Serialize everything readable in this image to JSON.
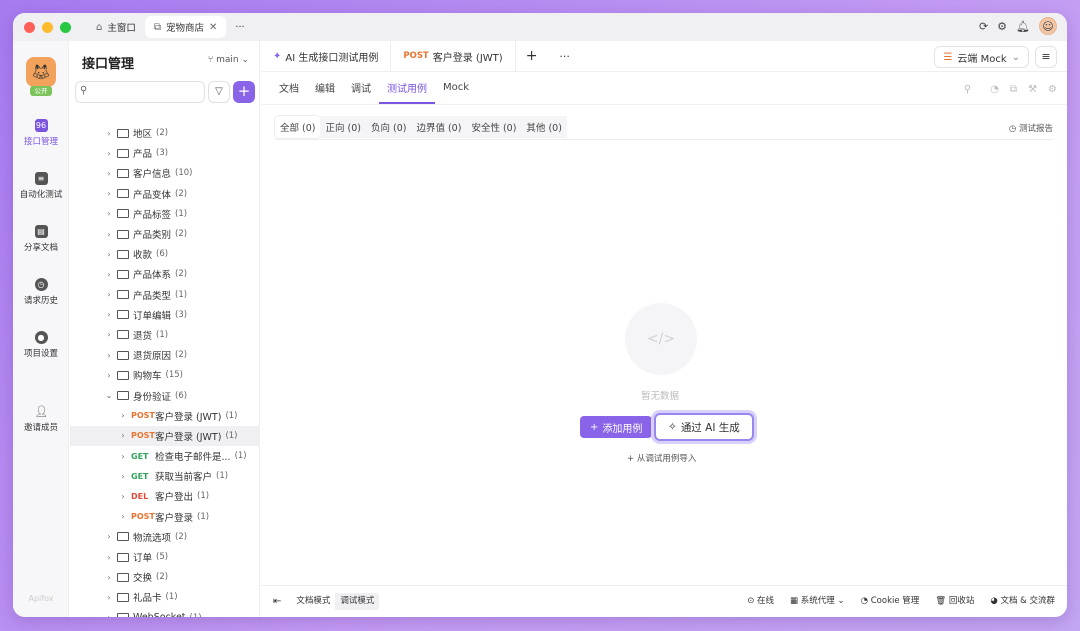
{
  "window": {
    "tabs": [
      {
        "label": "主窗口",
        "icon": "home-icon"
      },
      {
        "label": "宠物商店",
        "icon": "link-icon"
      }
    ],
    "more": "···"
  },
  "leftnav": {
    "public": "公开",
    "items": [
      {
        "label": "接口管理",
        "icon": "api-icon",
        "active": true
      },
      {
        "label": "自动化测试",
        "icon": "automation-icon"
      },
      {
        "label": "分享文档",
        "icon": "book-icon"
      },
      {
        "label": "请求历史",
        "icon": "clock-icon"
      },
      {
        "label": "项目设置",
        "icon": "settings-icon"
      },
      {
        "label": "邀请成员",
        "icon": "invite-icon"
      }
    ],
    "brand": "Apifox"
  },
  "tree": {
    "title": "接口管理",
    "branch": "main",
    "items": [
      {
        "type": "folder",
        "name": "地区",
        "count": "(2)"
      },
      {
        "type": "folder",
        "name": "产品",
        "count": "(3)"
      },
      {
        "type": "folder",
        "name": "客户信息",
        "count": "(10)"
      },
      {
        "type": "folder",
        "name": "产品变体",
        "count": "(2)"
      },
      {
        "type": "folder",
        "name": "产品标签",
        "count": "(1)"
      },
      {
        "type": "folder",
        "name": "产品类别",
        "count": "(2)"
      },
      {
        "type": "folder",
        "name": "收款",
        "count": "(6)"
      },
      {
        "type": "folder",
        "name": "产品体系",
        "count": "(2)"
      },
      {
        "type": "folder",
        "name": "产品类型",
        "count": "(1)"
      },
      {
        "type": "folder",
        "name": "订单编辑",
        "count": "(3)"
      },
      {
        "type": "folder",
        "name": "退货",
        "count": "(1)"
      },
      {
        "type": "folder",
        "name": "退货原因",
        "count": "(2)"
      },
      {
        "type": "folder",
        "name": "购物车",
        "count": "(15)"
      },
      {
        "type": "folder",
        "name": "身份验证",
        "count": "(6)",
        "open": true
      },
      {
        "type": "api",
        "method": "POST",
        "name": "客户登录 (JWT)",
        "count": "(1)"
      },
      {
        "type": "api",
        "method": "POST",
        "name": "客户登录 (JWT)",
        "count": "(1)",
        "selected": true
      },
      {
        "type": "api",
        "method": "GET",
        "name": "检查电子邮件是...",
        "count": "(1)"
      },
      {
        "type": "api",
        "method": "GET",
        "name": "获取当前客户",
        "count": "(1)"
      },
      {
        "type": "api",
        "method": "DEL",
        "name": "客户登出",
        "count": "(1)"
      },
      {
        "type": "api",
        "method": "POST",
        "name": "客户登录",
        "count": "(1)"
      },
      {
        "type": "folder",
        "name": "物流选项",
        "count": "(2)"
      },
      {
        "type": "folder",
        "name": "订单",
        "count": "(5)"
      },
      {
        "type": "folder",
        "name": "交换",
        "count": "(2)"
      },
      {
        "type": "folder",
        "name": "礼品卡",
        "count": "(1)"
      },
      {
        "type": "folder",
        "name": "WebSocket",
        "count": "(1)"
      }
    ]
  },
  "main": {
    "tabs": [
      {
        "label": "AI 生成接口测试用例",
        "icon": "sparkle-icon"
      },
      {
        "method": "POST",
        "label": "客户登录 (JWT)"
      }
    ],
    "env": "云端 Mock",
    "subtabs": [
      "文档",
      "编辑",
      "调试",
      "测试用例",
      "Mock"
    ],
    "active_subtab": 3,
    "filters": [
      "全部 (0)",
      "正向 (0)",
      "负向 (0)",
      "边界值 (0)",
      "安全性 (0)",
      "其他 (0)"
    ],
    "report": "测试报告",
    "empty": "暂无数据",
    "add_case": "添加用例",
    "ai_generate": "通过 AI 生成",
    "import": "从调试用例导入"
  },
  "footer": {
    "modes": [
      "文档模式",
      "调试模式"
    ],
    "items": [
      "在线",
      "系统代理",
      "Cookie 管理",
      "回收站",
      "文档 & 交流群"
    ]
  },
  "colors": {
    "accent": "#8a64e8",
    "post": "#e8742f",
    "get": "#2fa45a",
    "del": "#e04b3a"
  }
}
